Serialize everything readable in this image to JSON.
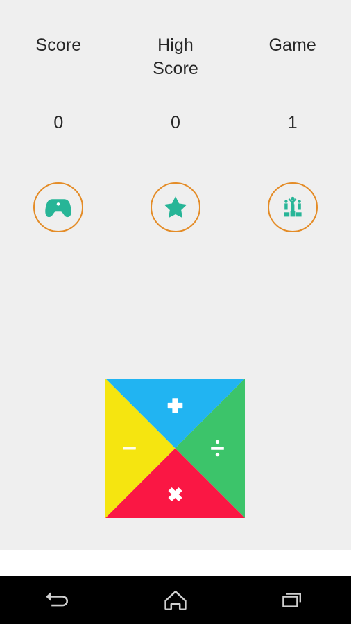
{
  "screen": {
    "background_color": "#efefef",
    "app_kind": "math-quiz-game"
  },
  "stats": {
    "columns": [
      {
        "label": "Score",
        "value": "0",
        "name": "score"
      },
      {
        "label": "High Score",
        "value": "0",
        "name": "high-score"
      },
      {
        "label": "Game",
        "value": "1",
        "name": "game"
      }
    ]
  },
  "actions": {
    "accent_color": "#e48c27",
    "icon_color": "#27b597",
    "buttons": [
      {
        "icon": "gamepad-icon",
        "name": "play-game-button"
      },
      {
        "icon": "star-icon",
        "name": "rate-button"
      },
      {
        "icon": "leaderboard-icon",
        "name": "leaderboard-button"
      }
    ]
  },
  "board": {
    "name": "operator-board",
    "quadrants": [
      {
        "position": "top",
        "operator": "+",
        "color": "#21b4f2",
        "name": "add-quadrant"
      },
      {
        "position": "right",
        "operator": "÷",
        "color": "#3cc46a",
        "name": "divide-quadrant"
      },
      {
        "position": "bottom",
        "operator": "×",
        "color": "#fa1744",
        "name": "multiply-quadrant"
      },
      {
        "position": "left",
        "operator": "−",
        "color": "#f5e510",
        "name": "subtract-quadrant"
      }
    ]
  },
  "navbar": {
    "background_color": "#000000",
    "buttons": [
      {
        "icon": "back-icon",
        "name": "nav-back-button"
      },
      {
        "icon": "home-icon",
        "name": "nav-home-button"
      },
      {
        "icon": "recents-icon",
        "name": "nav-recents-button"
      }
    ]
  }
}
